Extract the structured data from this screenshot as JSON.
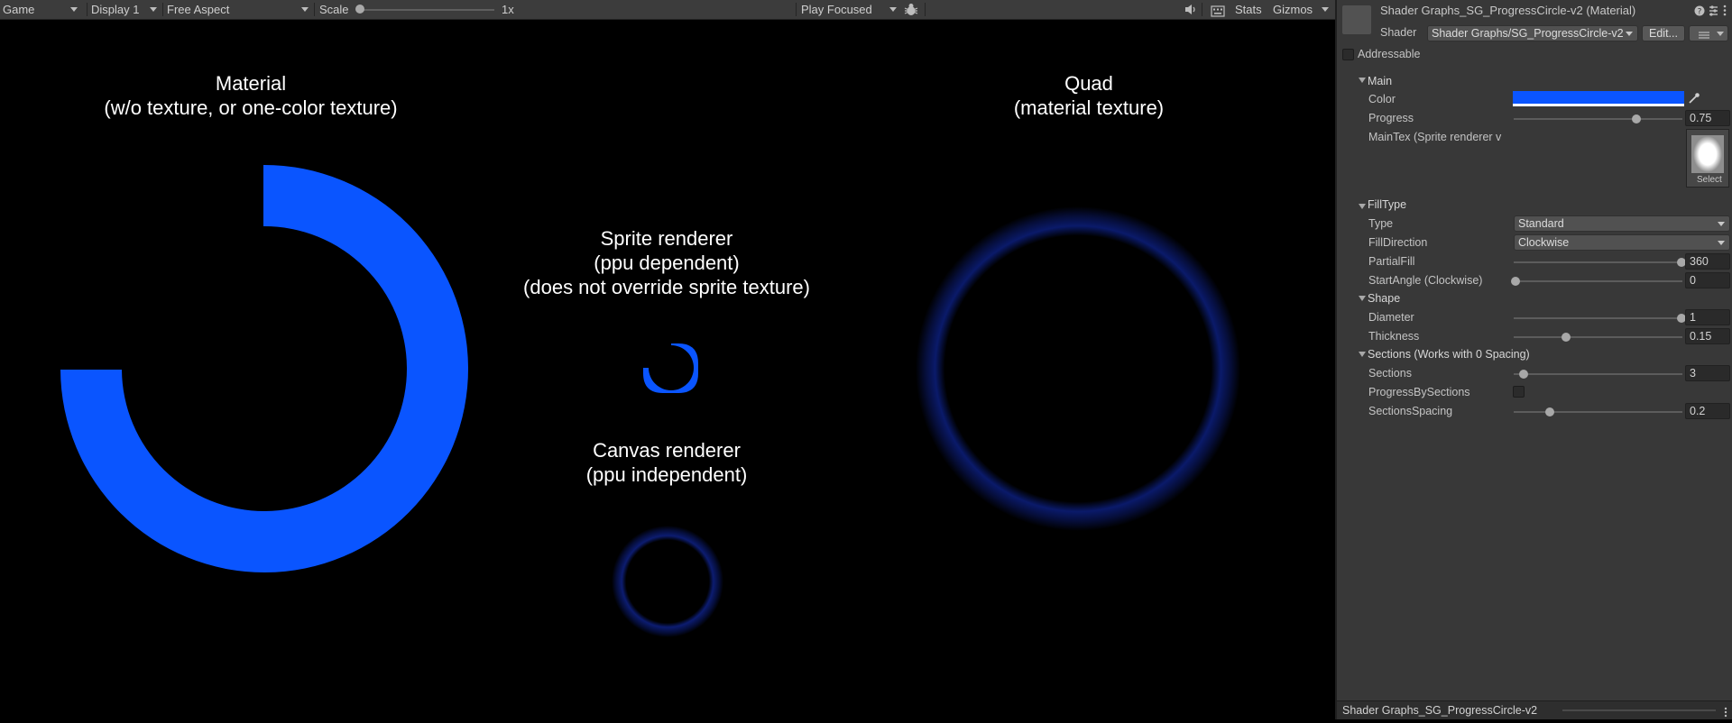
{
  "game_toolbar": {
    "tab": "Game",
    "display": "Display 1",
    "aspect": "Free Aspect",
    "scale_label": "Scale",
    "scale_value": "1x",
    "play_mode": "Play Focused",
    "stats": "Stats",
    "gizmos": "Gizmos"
  },
  "scene": {
    "material_label": "Material\n(w/o texture, or one-color texture)",
    "quad_label": "Quad\n(material texture)",
    "sprite_label": "Sprite renderer\n(ppu dependent)\n(does not override sprite texture)",
    "canvas_label": "Canvas renderer\n(ppu independent)"
  },
  "inspector": {
    "title": "Shader Graphs_SG_ProgressCircle-v2 (Material)",
    "shader_label": "Shader",
    "shader_value": "Shader Graphs/SG_ProgressCircle-v2",
    "edit_button": "Edit...",
    "addressable_label": "Addressable",
    "sections": {
      "main": "Main",
      "filltype": "FillType",
      "shape": "Shape",
      "sections": "Sections (Works with 0 Spacing)"
    },
    "props": {
      "color_label": "Color",
      "progress_label": "Progress",
      "progress_value": "0.75",
      "maintex_label": "MainTex (Sprite renderer v",
      "select_label": "Select",
      "type_label": "Type",
      "type_value": "Standard",
      "filldirection_label": "FillDirection",
      "filldirection_value": "Clockwise",
      "partialfill_label": "PartialFill",
      "partialfill_value": "360",
      "startangle_label": "StartAngle (Clockwise)",
      "startangle_value": "0",
      "diameter_label": "Diameter",
      "diameter_value": "1",
      "thickness_label": "Thickness",
      "thickness_value": "0.15",
      "sections_label": "Sections",
      "sections_value": "3",
      "progressbysections_label": "ProgressBySections",
      "sectionsspacing_label": "SectionsSpacing",
      "sectionsspacing_value": "0.2"
    },
    "footer": "Shader Graphs_SG_ProgressCircle-v2"
  },
  "colors": {
    "ring_blue": "#0a55ff",
    "panel_bg": "#383838",
    "toolbar_bg": "#3c3c3c"
  }
}
